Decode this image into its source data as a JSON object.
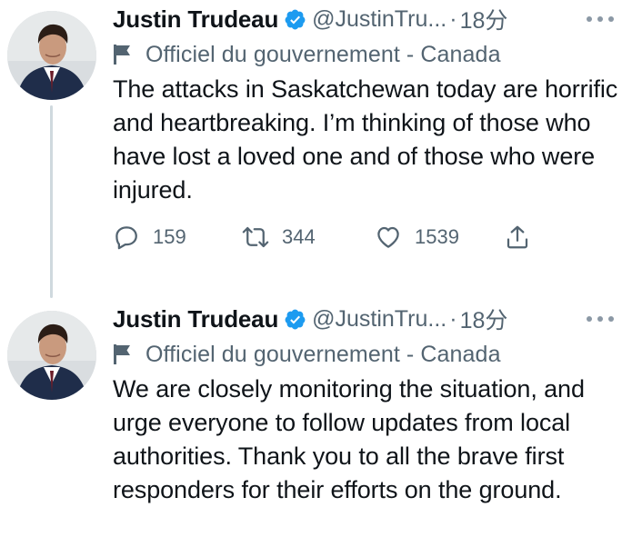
{
  "tweets": [
    {
      "author": {
        "name": "Justin Trudeau",
        "handle": "@JustinTru...",
        "avatar": "profile-photo"
      },
      "separator": "·",
      "time": "18分",
      "label": "Officiel du gouvernement - Canada",
      "text": "The attacks in Saskatchewan today are horrific and heartbreaking. I’m thinking of those who have lost a loved one and of those who were injured.",
      "stats": {
        "replies": "159",
        "retweets": "344",
        "likes": "1539"
      }
    },
    {
      "author": {
        "name": "Justin Trudeau",
        "handle": "@JustinTru...",
        "avatar": "profile-photo"
      },
      "separator": "·",
      "time": "18分",
      "label": "Officiel du gouvernement - Canada",
      "text": "We are closely monitoring the situation, and urge everyone to follow updates from local authorities. Thank you to all the brave first responders for their efforts on the ground."
    }
  ],
  "colors": {
    "verified": "#1d9bf0",
    "secondary_text": "#536471",
    "primary_text": "#0f1419",
    "thread_line": "#cfd9de"
  },
  "icons": {
    "verified": "verified-badge-icon",
    "more": "more-horizontal-icon",
    "flag": "government-flag-icon",
    "reply": "reply-icon",
    "retweet": "retweet-icon",
    "like": "heart-icon",
    "share": "share-icon"
  }
}
